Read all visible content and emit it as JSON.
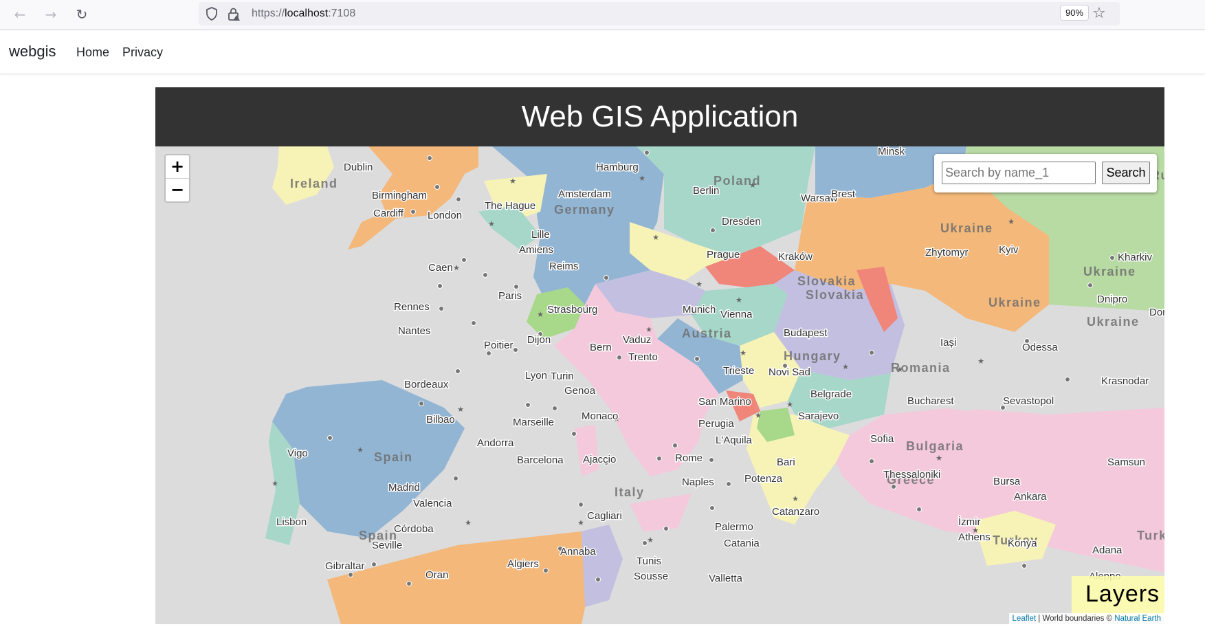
{
  "browser": {
    "url_protocol": "https://",
    "url_host": "localhost",
    "url_port": ":7108",
    "zoom_level": "90%"
  },
  "site": {
    "brand": "webgis",
    "nav": [
      "Home",
      "Privacy"
    ]
  },
  "app": {
    "title": "Web GIS Application"
  },
  "map": {
    "zoom_in": "+",
    "zoom_out": "−",
    "search": {
      "placeholder": "Search by name_1",
      "button_label": "Search"
    },
    "layers_label": "Layers",
    "attribution": {
      "leaflet": "Leaflet",
      "separator": " | World boundaries © ",
      "natural_earth": "Natural Earth"
    },
    "country_labels": [
      "Ireland",
      "Germany",
      "Poland",
      "Ukraine",
      "Ukraine",
      "Ukraine",
      "Ukraine",
      "Slovakia",
      "Slovakia",
      "Austria",
      "Hungary",
      "Romania",
      "Spain",
      "Spain",
      "Italy",
      "Bulgaria",
      "Greece",
      "Turkey",
      "Turkey",
      "Ru"
    ],
    "city_labels": [
      "Dublin",
      "Birmingham",
      "Cardiff",
      "London",
      "The Hague",
      "Amsterdam",
      "Hamburg",
      "Berlin",
      "Warsaw",
      "Brest",
      "Minsk",
      "Dresden",
      "Lille",
      "Amiens",
      "Caen",
      "Paris",
      "Reims",
      "Prague",
      "Kraków",
      "Zhytomyr",
      "Kyiv",
      "Kharkiv",
      "Rennes",
      "Nantes",
      "Strasbourg",
      "Munich",
      "Vienna",
      "Dnipro",
      "Don",
      "Poitier",
      "Dijon",
      "Bern",
      "Vaduz",
      "Budapest",
      "Iași",
      "Odessa",
      "Trento",
      "Trieste",
      "Lyon",
      "Turin",
      "Bordeaux",
      "Novi Sad",
      "Krasnodar",
      "Genoa",
      "San Marino",
      "Belgrade",
      "Bucharest",
      "Sevastopol",
      "Bilbao",
      "Marseille",
      "Monaco",
      "Sarajevo",
      "Perugia",
      "Andorra",
      "Vigo",
      "L'Aquila",
      "Sofia",
      "Barcelona",
      "Ajaccio",
      "Rome",
      "Bari",
      "Thessaloniki",
      "Samsun",
      "Madrid",
      "Naples",
      "Potenza",
      "Bursa",
      "Valencia",
      "Ankara",
      "Catanzaro",
      "Lisbon",
      "Córdoba",
      "Cagliari",
      "Palermo",
      "İzmir",
      "Seville",
      "Athens",
      "Catania",
      "Konya",
      "Annaba",
      "Adana",
      "Gibraltar",
      "Algiers",
      "Tunis",
      "Oran",
      "Sousse",
      "Valletta",
      "Aleppo"
    ]
  }
}
